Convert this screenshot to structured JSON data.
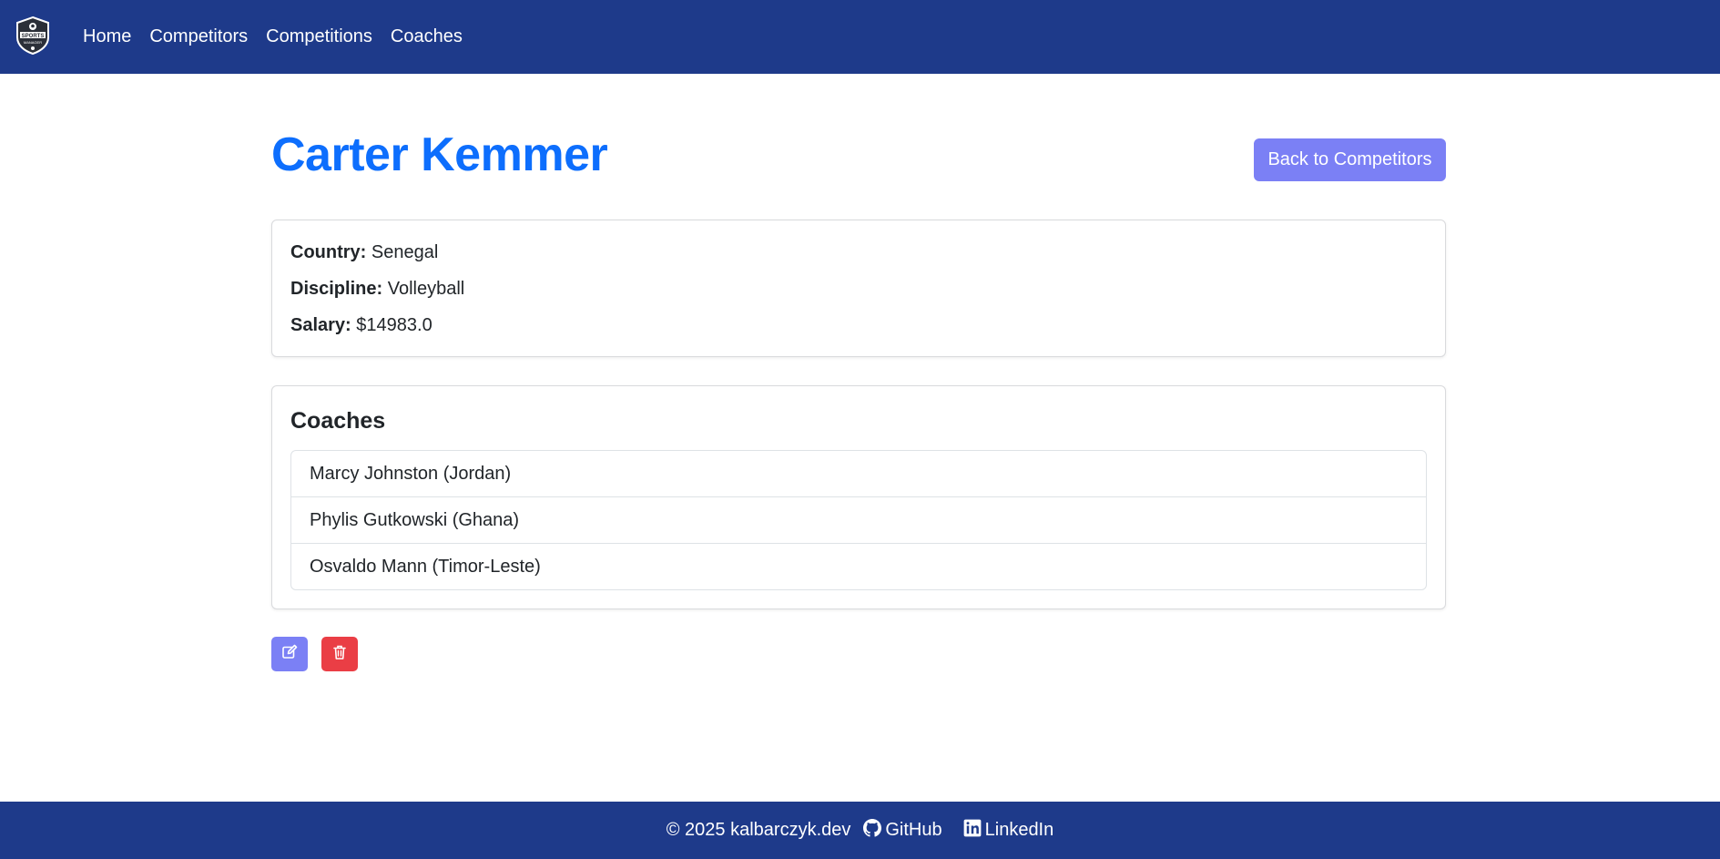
{
  "navbar": {
    "logo_text": "SPORTS MANAGER",
    "links": [
      "Home",
      "Competitors",
      "Competitions",
      "Coaches"
    ]
  },
  "competitor": {
    "name": "Carter Kemmer",
    "back_label": "Back to Competitors",
    "fields": [
      {
        "label": "Country:",
        "value": "Senegal"
      },
      {
        "label": "Discipline:",
        "value": "Volleyball"
      },
      {
        "label": "Salary:",
        "value": "$14983.0"
      }
    ]
  },
  "coaches": {
    "title": "Coaches",
    "items": [
      "Marcy Johnston (Jordan)",
      "Phylis Gutkowski (Ghana)",
      "Osvaldo Mann (Timor-Leste)"
    ]
  },
  "actions": {
    "edit_icon": "edit-icon",
    "delete_icon": "trash-icon"
  },
  "footer": {
    "copyright": "© 2025 kalbarczyk.dev",
    "github": "GitHub",
    "linkedin": "LinkedIn"
  },
  "colors": {
    "navbar": "#1e3a8a",
    "title": "#0d6efd",
    "primary_button": "#7b80f5",
    "danger_button": "#ea3e45"
  }
}
